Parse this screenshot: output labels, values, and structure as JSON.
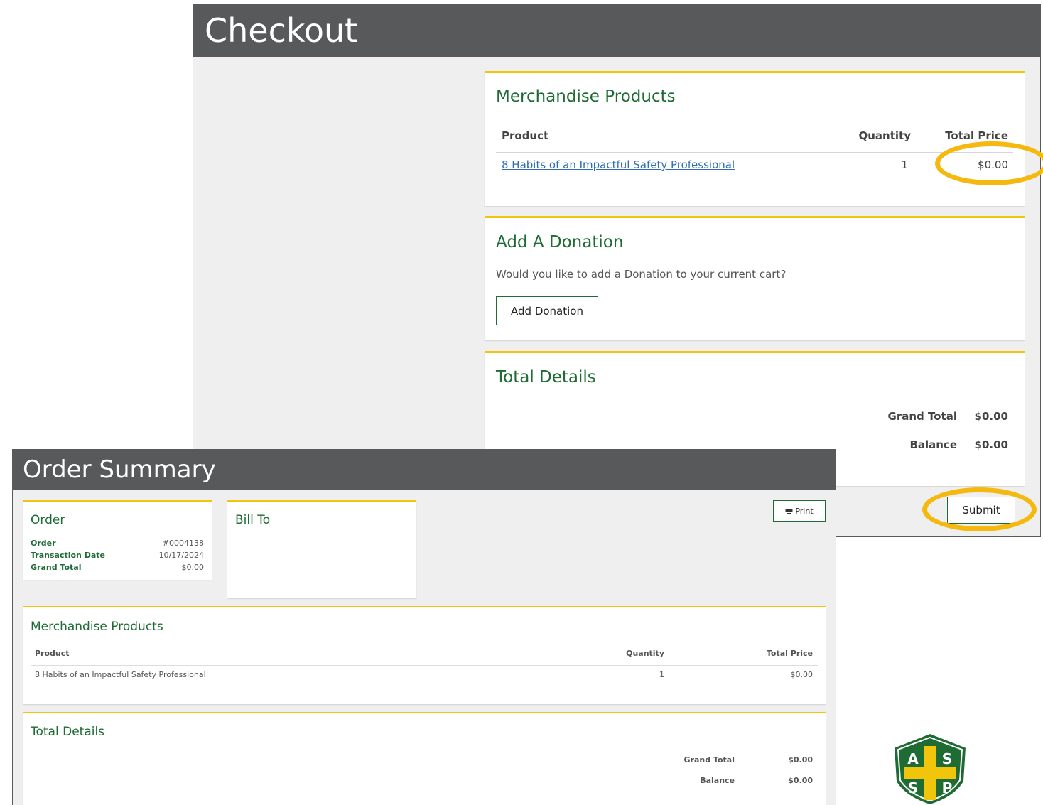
{
  "checkout": {
    "title": "Checkout",
    "merchandise": {
      "title": "Merchandise Products",
      "headers": {
        "product": "Product",
        "quantity": "Quantity",
        "total_price": "Total Price"
      },
      "rows": [
        {
          "product": "8 Habits of an Impactful Safety Professional",
          "quantity": "1",
          "total_price": "$0.00"
        }
      ]
    },
    "donation": {
      "title": "Add A Donation",
      "prompt": "Would you like to add a Donation to your current cart?",
      "button_label": "Add Donation"
    },
    "totals": {
      "title": "Total Details",
      "grand_total_label": "Grand Total",
      "grand_total_value": "$0.00",
      "balance_label": "Balance",
      "balance_value": "$0.00"
    },
    "submit_label": "Submit"
  },
  "order_summary": {
    "title": "Order Summary",
    "print_label": "Print",
    "order": {
      "title": "Order",
      "order_label": "Order",
      "order_value": "#0004138",
      "transaction_date_label": "Transaction Date",
      "transaction_date_value": "10/17/2024",
      "grand_total_label": "Grand Total",
      "grand_total_value": "$0.00"
    },
    "bill_to": {
      "title": "Bill To"
    },
    "merchandise": {
      "title": "Merchandise Products",
      "headers": {
        "product": "Product",
        "quantity": "Quantity",
        "total_price": "Total Price"
      },
      "rows": [
        {
          "product": "8 Habits of an Impactful Safety Professional",
          "quantity": "1",
          "total_price": "$0.00"
        }
      ]
    },
    "totals": {
      "title": "Total Details",
      "grand_total_label": "Grand Total",
      "grand_total_value": "$0.00",
      "balance_label": "Balance",
      "balance_value": "$0.00"
    }
  },
  "logo": {
    "name": "ASSP",
    "letters": [
      "A",
      "S",
      "S",
      "P"
    ]
  },
  "colors": {
    "header_bg": "#58595b",
    "accent_yellow": "#f2c50d",
    "brand_green": "#1e6b34",
    "link_blue": "#2f6db5",
    "highlight_ring": "#f5b80f"
  }
}
